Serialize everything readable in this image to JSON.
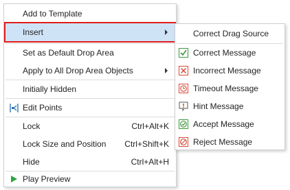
{
  "main_menu": {
    "items": [
      {
        "label": "Add to Template"
      },
      {
        "label": "Insert"
      },
      {
        "label": "Set as Default Drop Area"
      },
      {
        "label": "Apply to All Drop Area Objects"
      },
      {
        "label": "Initially Hidden"
      },
      {
        "label": "Edit Points",
        "icon": "edit-points-icon"
      },
      {
        "label": "Lock",
        "shortcut": "Ctrl+Alt+K"
      },
      {
        "label": "Lock Size and Position",
        "shortcut": "Ctrl+Shift+K"
      },
      {
        "label": "Hide",
        "shortcut": "Ctrl+Alt+H"
      },
      {
        "label": "Play Preview",
        "icon": "play-icon"
      }
    ]
  },
  "insert_submenu": {
    "items": [
      {
        "label": "Correct Drag Source"
      },
      {
        "label": "Correct Message",
        "icon": "check-icon"
      },
      {
        "label": "Incorrect Message",
        "icon": "x-icon"
      },
      {
        "label": "Timeout Message",
        "icon": "clock-icon"
      },
      {
        "label": "Hint Message",
        "icon": "hint-icon"
      },
      {
        "label": "Accept Message",
        "icon": "accept-icon"
      },
      {
        "label": "Reject Message",
        "icon": "reject-icon"
      }
    ]
  },
  "colors": {
    "highlight_bg": "#cfe3f7",
    "highlight_border": "#e01b1b",
    "play_icon": "#2fa640",
    "icon_green": "#3a9a3a",
    "icon_red": "#d94a3a"
  }
}
